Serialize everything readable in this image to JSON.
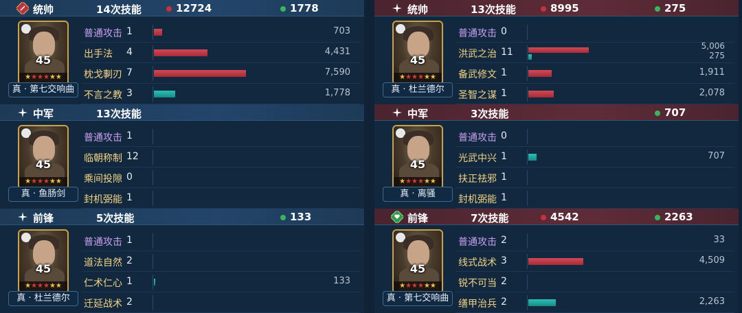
{
  "colors": {
    "damage": "#c8303a",
    "heal": "#37b65a",
    "bar_red": "#c8404c",
    "bar_teal": "#22aaa2",
    "skill_gold": "#f2d283",
    "skill_normal": "#c8a0f0"
  },
  "left": {
    "sections": [
      {
        "role": "统帅",
        "count": "14次技能",
        "damage": "12724",
        "heal": "1778",
        "badge_icon": "commander-badge-icon",
        "hero": {
          "level": "45",
          "name": "真 · 第七交响曲"
        },
        "skills": [
          {
            "name": "普通攻击",
            "times": "1",
            "value": "703",
            "bar_fraction": 0.093,
            "bar_color": "red",
            "normal": true
          },
          {
            "name": "出手法",
            "times": "4",
            "value": "4,431",
            "bar_fraction": 0.584,
            "bar_color": "red"
          },
          {
            "name": "枕戈剚刃",
            "times": "7",
            "value": "7,590",
            "bar_fraction": 1.0,
            "bar_color": "red"
          },
          {
            "name": "不言之教",
            "times": "3",
            "value": "1,778",
            "bar_fraction": 0.234,
            "bar_color": "teal"
          }
        ]
      },
      {
        "role": "中军",
        "count": "13次技能",
        "damage": "",
        "heal": "",
        "hero": {
          "level": "45",
          "name": "真 · 鱼肠剑"
        },
        "skills": [
          {
            "name": "普通攻击",
            "times": "1",
            "value": "",
            "bar_fraction": 0,
            "normal": true
          },
          {
            "name": "临朝称制",
            "times": "12",
            "value": "",
            "bar_fraction": 0
          },
          {
            "name": "乘间投隙",
            "times": "0",
            "value": "",
            "bar_fraction": 0
          },
          {
            "name": "封机弼能",
            "times": "1",
            "value": "",
            "bar_fraction": 0
          }
        ]
      },
      {
        "role": "前锋",
        "count": "5次技能",
        "damage": "",
        "heal": "133",
        "hero": {
          "level": "45",
          "name": "真 · 杜兰德尔"
        },
        "skills": [
          {
            "name": "普通攻击",
            "times": "1",
            "value": "",
            "bar_fraction": 0,
            "normal": true
          },
          {
            "name": "道法自然",
            "times": "2",
            "value": "",
            "bar_fraction": 0
          },
          {
            "name": "仁术仁心",
            "times": "1",
            "value": "133",
            "bar_fraction": 0.01,
            "bar_color": "teal"
          },
          {
            "name": "迁延战术",
            "times": "2",
            "value": "",
            "bar_fraction": 0
          }
        ]
      }
    ]
  },
  "right": {
    "sections": [
      {
        "role": "统帅",
        "count": "13次技能",
        "damage": "8995",
        "heal": "275",
        "hero": {
          "level": "45",
          "name": "真 · 杜兰德尔"
        },
        "skills": [
          {
            "name": "普通攻击",
            "times": "0",
            "value": "",
            "bar_fraction": 0,
            "normal": true
          },
          {
            "name": "洪武之治",
            "times": "11",
            "value": "5,006",
            "value2": "275",
            "bar_fraction": 0.66,
            "bar_color": "red",
            "bar2_fraction": 0.036,
            "bar2_color": "teal"
          },
          {
            "name": "备武修文",
            "times": "1",
            "value": "1,911",
            "bar_fraction": 0.252,
            "bar_color": "red"
          },
          {
            "name": "圣智之谋",
            "times": "1",
            "value": "2,078",
            "bar_fraction": 0.274,
            "bar_color": "red"
          }
        ]
      },
      {
        "role": "中军",
        "count": "3次技能",
        "damage": "",
        "heal": "707",
        "hero": {
          "level": "45",
          "name": "真 · 离骚"
        },
        "skills": [
          {
            "name": "普通攻击",
            "times": "0",
            "value": "",
            "bar_fraction": 0,
            "normal": true
          },
          {
            "name": "光武中兴",
            "times": "1",
            "value": "707",
            "bar_fraction": 0.093,
            "bar_color": "teal"
          },
          {
            "name": "扶正祛邪",
            "times": "1",
            "value": "",
            "bar_fraction": 0
          },
          {
            "name": "封机弼能",
            "times": "1",
            "value": "",
            "bar_fraction": 0
          }
        ]
      },
      {
        "role": "前锋",
        "count": "7次技能",
        "damage": "4542",
        "heal": "2263",
        "badge_icon": "vanguard-heart-badge-icon",
        "hero": {
          "level": "45",
          "name": "真 · 第七交响曲"
        },
        "skills": [
          {
            "name": "普通攻击",
            "times": "2",
            "value": "33",
            "bar_fraction": 0,
            "normal": true
          },
          {
            "name": "线式战术",
            "times": "3",
            "value": "4,509",
            "bar_fraction": 0.594,
            "bar_color": "red"
          },
          {
            "name": "锐不可当",
            "times": "2",
            "value": "",
            "bar_fraction": 0
          },
          {
            "name": "缮甲治兵",
            "times": "2",
            "value": "2,263",
            "bar_fraction": 0.298,
            "bar_color": "teal"
          }
        ]
      }
    ]
  }
}
